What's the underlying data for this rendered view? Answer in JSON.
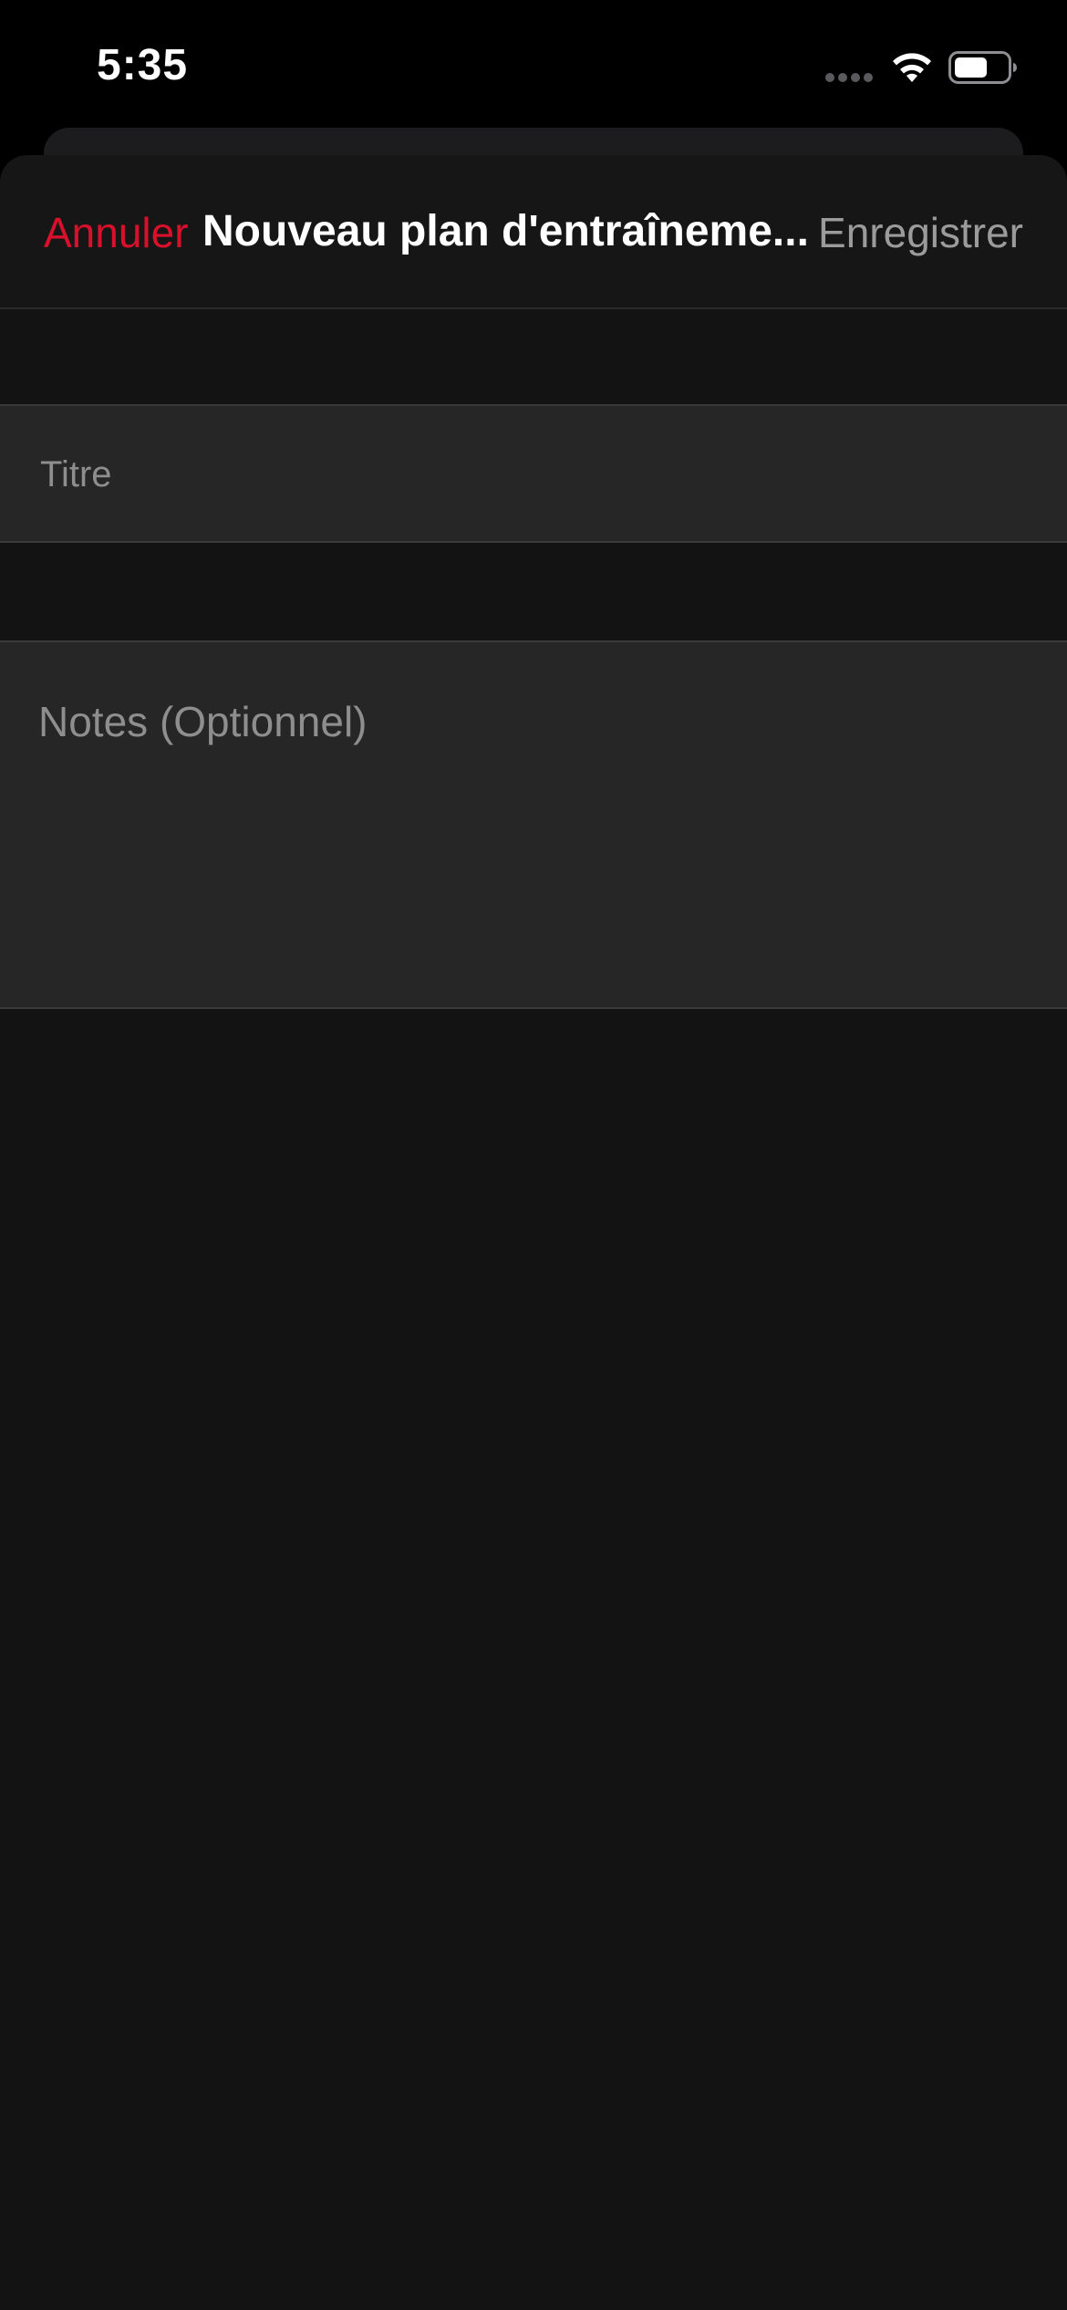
{
  "status_bar": {
    "time": "5:35",
    "icons": [
      "signal-icon",
      "wifi-icon",
      "battery-icon"
    ]
  },
  "nav": {
    "cancel_label": "Annuler",
    "title": "Nouveau plan d'entraîneme...",
    "save_label": "Enregistrer"
  },
  "form": {
    "title_placeholder": "Titre",
    "title_value": "",
    "notes_placeholder": "Notes (Optionnel)",
    "notes_value": ""
  },
  "colors": {
    "accent": "#d9102b",
    "background": "#131313",
    "field_background": "#262626",
    "disabled_text": "#9b9b9b"
  }
}
